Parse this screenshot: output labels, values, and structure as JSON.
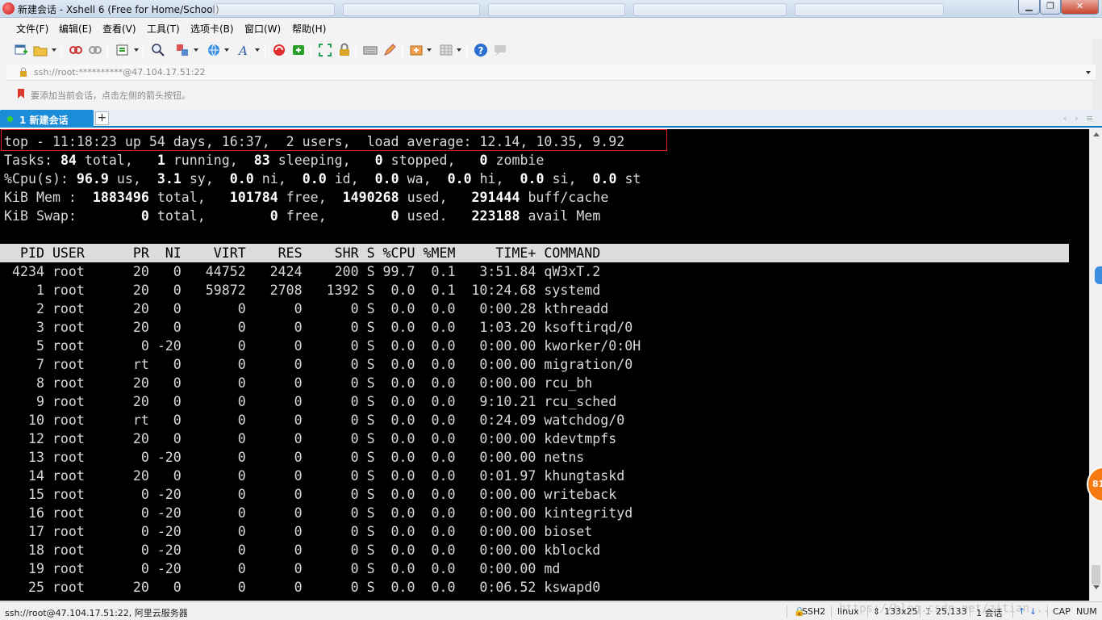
{
  "window": {
    "title": "新建会话 - Xshell 6 (Free for Home/School)"
  },
  "menu": {
    "items": [
      "文件(F)",
      "编辑(E)",
      "查看(V)",
      "工具(T)",
      "选项卡(B)",
      "窗口(W)",
      "帮助(H)"
    ]
  },
  "address": {
    "value": "ssh://root:**********@47.104.17.51:22"
  },
  "hint": {
    "text": "要添加当前会话，点击左侧的箭头按钮。"
  },
  "tabs": {
    "active_label": "1 新建会话",
    "add_label": "+"
  },
  "terminal": {
    "summary": {
      "line1": "top - 11:18:23 up 54 days, 16:37,  2 users,  load average: 12.14, 10.35, 9.92",
      "tasks": [
        "Tasks: ",
        "84",
        " total,   ",
        "1",
        " running,  ",
        "83",
        " sleeping,   ",
        "0",
        " stopped,   ",
        "0",
        " zombie"
      ],
      "cpu": [
        "%Cpu(s): ",
        "96.9",
        " us,  ",
        "3.1",
        " sy,  ",
        "0.0",
        " ni,  ",
        "0.0",
        " id,  ",
        "0.0",
        " wa,  ",
        "0.0",
        " hi,  ",
        "0.0",
        " si,  ",
        "0.0",
        " st"
      ],
      "mem": [
        "KiB Mem :  ",
        "1883496",
        " total,   ",
        "101784",
        " free,  ",
        "1490268",
        " used,   ",
        "291444",
        " buff/cache"
      ],
      "swap": [
        "KiB Swap:        ",
        "0",
        " total,        ",
        "0",
        " free,        ",
        "0",
        " used.   ",
        "223188",
        " avail Mem"
      ]
    },
    "header": "  PID USER      PR  NI    VIRT    RES    SHR S %CPU %MEM     TIME+ COMMAND",
    "processes": [
      " 4234 root      20   0   44752   2424    200 S 99.7  0.1   3:51.84 qW3xT.2",
      "    1 root      20   0   59872   2708   1392 S  0.0  0.1  10:24.68 systemd",
      "    2 root      20   0       0      0      0 S  0.0  0.0   0:00.28 kthreadd",
      "    3 root      20   0       0      0      0 S  0.0  0.0   1:03.20 ksoftirqd/0",
      "    5 root       0 -20       0      0      0 S  0.0  0.0   0:00.00 kworker/0:0H",
      "    7 root      rt   0       0      0      0 S  0.0  0.0   0:00.00 migration/0",
      "    8 root      20   0       0      0      0 S  0.0  0.0   0:00.00 rcu_bh",
      "    9 root      20   0       0      0      0 S  0.0  0.0   9:10.21 rcu_sched",
      "   10 root      rt   0       0      0      0 S  0.0  0.0   0:24.09 watchdog/0",
      "   12 root      20   0       0      0      0 S  0.0  0.0   0:00.00 kdevtmpfs",
      "   13 root       0 -20       0      0      0 S  0.0  0.0   0:00.00 netns",
      "   14 root      20   0       0      0      0 S  0.0  0.0   0:01.97 khungtaskd",
      "   15 root       0 -20       0      0      0 S  0.0  0.0   0:00.00 writeback",
      "   16 root       0 -20       0      0      0 S  0.0  0.0   0:00.00 kintegrityd",
      "   17 root       0 -20       0      0      0 S  0.0  0.0   0:00.00 bioset",
      "   18 root       0 -20       0      0      0 S  0.0  0.0   0:00.00 kblockd",
      "   19 root       0 -20       0      0      0 S  0.0  0.0   0:00.00 md",
      "   25 root      20   0       0      0      0 S  0.0  0.0   0:06.52 kswapd0"
    ]
  },
  "status": {
    "connection": "ssh://root@47.104.17.51:22, 阿里云服务器",
    "protocol": "SSH2",
    "term_type": "linux",
    "size": "133x25",
    "cursor": "25,133",
    "sessions": "1 会话",
    "caps": "CAP",
    "num": "NUM",
    "watermark": "https://blog.csdn.net/zitian..."
  },
  "side_badge": "81",
  "colors": {
    "tab_active": "#1a8cd8",
    "terminal_bg": "#000000",
    "highlight": "#e02020"
  }
}
